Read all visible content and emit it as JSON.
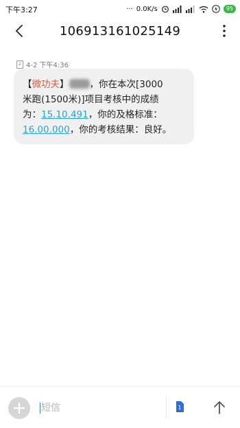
{
  "status": {
    "time": "下午3:27",
    "more": "···",
    "speed": "0.0K/s",
    "battery": "95"
  },
  "header": {
    "title": "106913161025149"
  },
  "message": {
    "sim": "2",
    "date": "4-2 下午4:36",
    "bracket_open": "【",
    "tag": "微功夫",
    "bracket_close": "】",
    "line1_after_name": "，你在本次[3000",
    "line2": "米跑(1500米)]项目考核中的成绩",
    "line3_prefix": "为：",
    "score": "15.10.491",
    "line3_suffix": "，你的及格标准：",
    "standard": "16.00.000",
    "line4_suffix": "，你的考核结果：良好。"
  },
  "composer": {
    "placeholder": "短信",
    "sim_label": "1"
  },
  "colors": {
    "accent": "#e8553b",
    "link": "#2aa0d8",
    "bubble": "#f0f0f0",
    "battery": "#3cb54a"
  }
}
